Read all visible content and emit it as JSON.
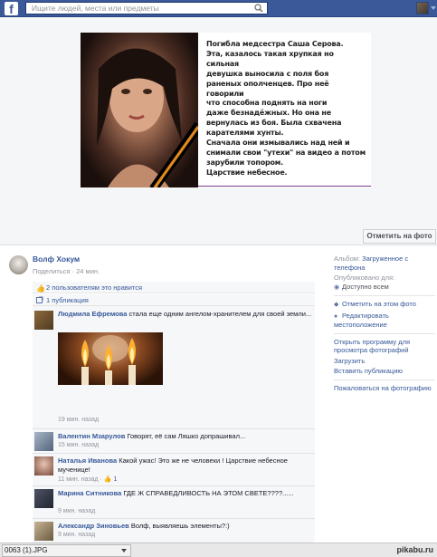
{
  "header": {
    "search_placeholder": "Ищите людей, места или предметы",
    "logo_letter": "f"
  },
  "photo": {
    "text_lines": [
      "Погибла медсестра Саша Серова.",
      "Эта, казалось такая хрупкая но сильная",
      "девушка выносила с поля боя",
      "раненых ополченцев. Про неё говорили",
      "что способна поднять на ноги",
      "даже безнадёжных. Но она не",
      "вернулась из боя. Была схвачена",
      "карателями хунты.",
      "Сначала они измывались над ней и",
      "снимали свои \"утехи\" на видео а потом",
      "зарубили топором.",
      "Царствие небесное."
    ],
    "tag_button": "Отметить на фото"
  },
  "post": {
    "author": "Волф Хокум",
    "share_link": "Поделиться",
    "time": "24 мин.",
    "likes_text": "2 пользователям это нравится",
    "shares_text": "1 публикация"
  },
  "comments": [
    {
      "author": "Людмила Ефремова",
      "text": "стала еще одним ангелом-хранителем для своей земли...",
      "time": "19 мин. назад",
      "has_image": true
    },
    {
      "author": "Валентин Мзарулов",
      "text": "Говорят, её сам Ляшко допрашивал...",
      "time": "15 мин. назад"
    },
    {
      "author": "Наталья Иванова",
      "text": "Какой ужас! Это же не человеки ! Царствие небесное мученице!",
      "time": "11 мин. назад",
      "likes": "1"
    },
    {
      "author": "Марина Ситникова",
      "text": "ГДЕ Ж СПРАВЕДЛИВОСТЬ НА ЭТОМ СВЕТЕ????......",
      "time": "9 мин. назад"
    },
    {
      "author": "Александр Зиновьев",
      "text": "Волф, выявляешь элементы?:)",
      "time": "9 мин. назад"
    }
  ],
  "sidebar": {
    "album_label": "Альбом:",
    "album_value": "Загруженное с телефона",
    "published_label": "Опубликовано для:",
    "published_value": "Доступно всем",
    "tag_photo": "Отметить на этом фото",
    "edit_location": "Редактировать местоположение",
    "open_viewer": "Открыть программу для просмотра фотографий",
    "download": "Загрузить",
    "embed": "Вставить публикацию",
    "report": "Пожаловаться на фотографию"
  },
  "download_bar": {
    "filename": "0063 (1).JPG",
    "watermark": "pikabu.ru"
  }
}
